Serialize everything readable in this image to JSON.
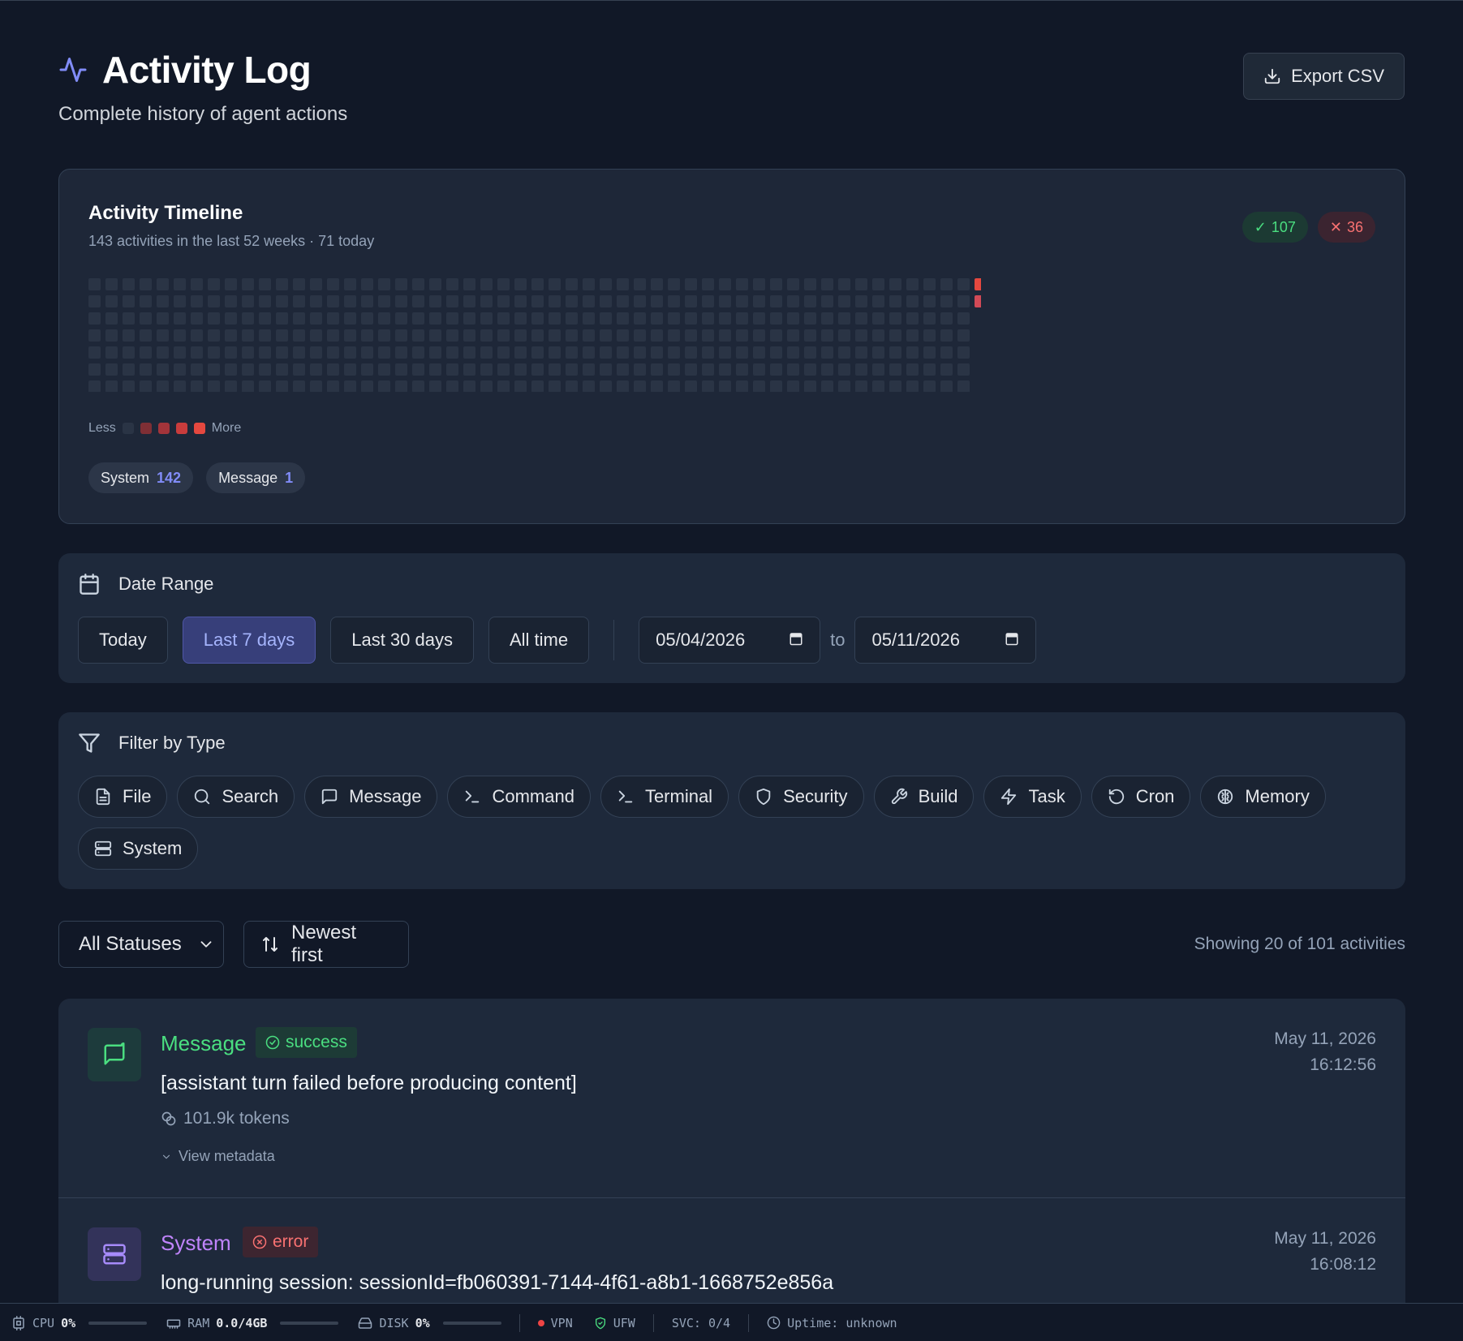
{
  "header": {
    "title": "Activity Log",
    "subtitle": "Complete history of agent actions",
    "export_label": "Export CSV"
  },
  "timeline": {
    "title": "Activity Timeline",
    "subtitle": "143 activities in the last 52 weeks · 71 today",
    "success_count": "107",
    "error_count": "36",
    "legend_less": "Less",
    "legend_more": "More",
    "legend_colors": [
      "#2a3445",
      "#7f2f35",
      "#a3343a",
      "#c93c3c",
      "#e5483f"
    ],
    "empty_color": "#2a3445",
    "weeks": 53,
    "days": 7,
    "active_cells": [
      {
        "week": 52,
        "day": 0,
        "color": "#e5483f"
      },
      {
        "week": 52,
        "day": 1,
        "color": "#d24a57"
      }
    ],
    "type_counts": [
      {
        "label": "System",
        "count": "142"
      },
      {
        "label": "Message",
        "count": "1"
      }
    ]
  },
  "date_range": {
    "label": "Date Range",
    "options": [
      "Today",
      "Last 7 days",
      "Last 30 days",
      "All time"
    ],
    "active": "Last 7 days",
    "from": "05/04/2026",
    "to_label": "to",
    "to": "05/11/2026"
  },
  "filter": {
    "label": "Filter by Type",
    "types": [
      {
        "label": "File",
        "icon": "file-icon"
      },
      {
        "label": "Search",
        "icon": "search-icon"
      },
      {
        "label": "Message",
        "icon": "message-icon"
      },
      {
        "label": "Command",
        "icon": "command-icon"
      },
      {
        "label": "Terminal",
        "icon": "terminal-icon"
      },
      {
        "label": "Security",
        "icon": "shield-icon"
      },
      {
        "label": "Build",
        "icon": "wrench-icon"
      },
      {
        "label": "Task",
        "icon": "zap-icon"
      },
      {
        "label": "Cron",
        "icon": "rotate-icon"
      },
      {
        "label": "Memory",
        "icon": "brain-icon"
      },
      {
        "label": "System",
        "icon": "server-icon"
      }
    ]
  },
  "toolbar": {
    "status_select": "All Statuses",
    "sort_label": "Newest first",
    "showing": "Showing 20 of 101 activities"
  },
  "activities": [
    {
      "type": "Message",
      "status": "success",
      "description": "[assistant turn failed before producing content]",
      "tokens": "101.9k tokens",
      "metadata_label": "View metadata",
      "date": "May 11, 2026",
      "time": "16:12:56"
    },
    {
      "type": "System",
      "status": "error",
      "description": "long-running session: sessionId=fb060391-7144-4f61-a8b1-1668752e856a",
      "date": "May 11, 2026",
      "time": "16:08:12"
    }
  ],
  "statusbar": {
    "cpu_label": "CPU",
    "cpu_value": "0%",
    "ram_label": "RAM",
    "ram_value": "0.0/4GB",
    "disk_label": "DISK",
    "disk_value": "0%",
    "vpn_label": "VPN",
    "ufw_label": "UFW",
    "svc_label": "SVC: 0/4",
    "uptime_label": "Uptime: unknown"
  }
}
